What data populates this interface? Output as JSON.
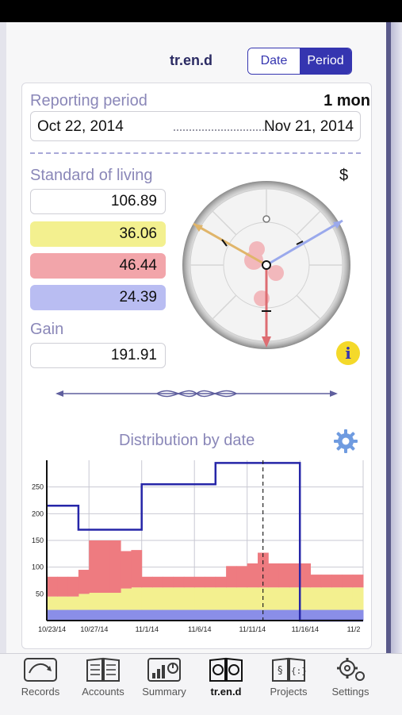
{
  "header": {
    "title": "tr.en.d",
    "segments": [
      "Date",
      "Period"
    ],
    "selected_segment": "Period"
  },
  "period": {
    "label": "Reporting period",
    "length": "1 mon",
    "start": "Oct 22, 2014",
    "end": "Nov 21, 2014"
  },
  "standard": {
    "label": "Standard of living",
    "currency": "$",
    "total": "106.89",
    "values": [
      "36.06",
      "46.44",
      "24.39"
    ],
    "colors": [
      "#f3f08f",
      "#f2a5aa",
      "#b9bdf2"
    ]
  },
  "gain": {
    "label": "Gain",
    "value": "191.91"
  },
  "info_icon": "i",
  "chart_title": "Distribution by date",
  "chart_data": {
    "type": "area",
    "title": "Distribution by date",
    "x": [
      "10/23/14",
      "10/24/14",
      "10/25/14",
      "10/26/14",
      "10/27/14",
      "10/28/14",
      "10/29/14",
      "10/30/14",
      "10/31/14",
      "11/1/14",
      "11/2/14",
      "11/3/14",
      "11/4/14",
      "11/5/14",
      "11/6/14",
      "11/7/14",
      "11/8/14",
      "11/9/14",
      "11/10/14",
      "11/11/14",
      "11/12/14",
      "11/13/14",
      "11/14/14",
      "11/15/14",
      "11/16/14",
      "11/17/14",
      "11/18/14",
      "11/19/14",
      "11/20/14",
      "11/21/14"
    ],
    "xticks": [
      "10/23/14",
      "10/27/14",
      "11/1/14",
      "11/6/14",
      "11/11/14",
      "11/16/14",
      "11/2"
    ],
    "yticks": [
      50,
      100,
      150,
      200,
      250
    ],
    "ylim": [
      0,
      300
    ],
    "series": [
      {
        "color": "#8a8ee8",
        "values": [
          20,
          20,
          20,
          20,
          20,
          20,
          20,
          20,
          20,
          20,
          20,
          20,
          20,
          20,
          20,
          20,
          20,
          20,
          20,
          20,
          20,
          20,
          20,
          20,
          20,
          20,
          20,
          20,
          20,
          20
        ]
      },
      {
        "color": "#f3f08f",
        "values": [
          25,
          25,
          25,
          30,
          32,
          32,
          32,
          40,
          42,
          42,
          42,
          42,
          42,
          42,
          42,
          42,
          42,
          42,
          42,
          42,
          42,
          42,
          42,
          42,
          42,
          42,
          42,
          42,
          42,
          42
        ]
      },
      {
        "color": "#ee7b80",
        "values": [
          37,
          37,
          37,
          45,
          98,
          98,
          98,
          70,
          70,
          20,
          20,
          20,
          20,
          20,
          20,
          20,
          20,
          40,
          40,
          45,
          65,
          45,
          45,
          45,
          45,
          24,
          24,
          24,
          24,
          24
        ]
      }
    ],
    "step_line": {
      "color": "#2626a8",
      "values": [
        215,
        215,
        215,
        170,
        170,
        170,
        170,
        170,
        170,
        255,
        255,
        255,
        255,
        255,
        255,
        255,
        295,
        295,
        295,
        295,
        295,
        295,
        295,
        295,
        0,
        0,
        0,
        0,
        0,
        0
      ]
    },
    "marker_x": "11/12/14"
  },
  "tabbar": {
    "items": [
      {
        "label": "Records",
        "icon": "records-icon"
      },
      {
        "label": "Accounts",
        "icon": "accounts-icon"
      },
      {
        "label": "Summary",
        "icon": "summary-icon"
      },
      {
        "label": "tr.en.d",
        "icon": "trend-icon"
      },
      {
        "label": "Projects",
        "icon": "projects-icon"
      },
      {
        "label": "Settings",
        "icon": "settings-icon"
      }
    ],
    "active": 3
  }
}
